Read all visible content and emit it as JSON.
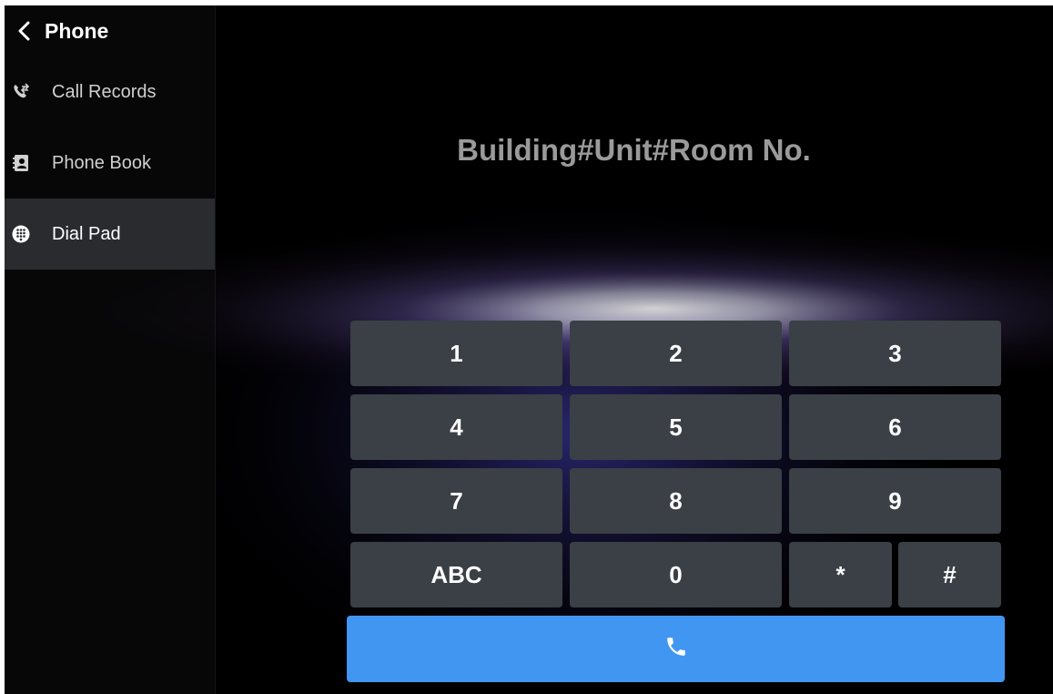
{
  "header": {
    "title": "Phone"
  },
  "sidebar": {
    "items": [
      {
        "label": "Call Records",
        "icon": "call-records-icon",
        "active": false
      },
      {
        "label": "Phone Book",
        "icon": "phone-book-icon",
        "active": false
      },
      {
        "label": "Dial Pad",
        "icon": "dial-pad-icon",
        "active": true
      }
    ]
  },
  "dialpad": {
    "placeholder": "Building#Unit#Room No.",
    "keys": {
      "k1": "1",
      "k2": "2",
      "k3": "3",
      "k4": "4",
      "k5": "5",
      "k6": "6",
      "k7": "7",
      "k8": "8",
      "k9": "9",
      "abc": "ABC",
      "k0": "0",
      "star": "*",
      "hash": "#"
    },
    "call_icon": "phone-icon"
  },
  "colors": {
    "background": "#000000",
    "key": "#3b3f46",
    "call_button": "#4196f2",
    "active_item": "#2a2b2f",
    "placeholder_text": "#9a9a9a"
  }
}
